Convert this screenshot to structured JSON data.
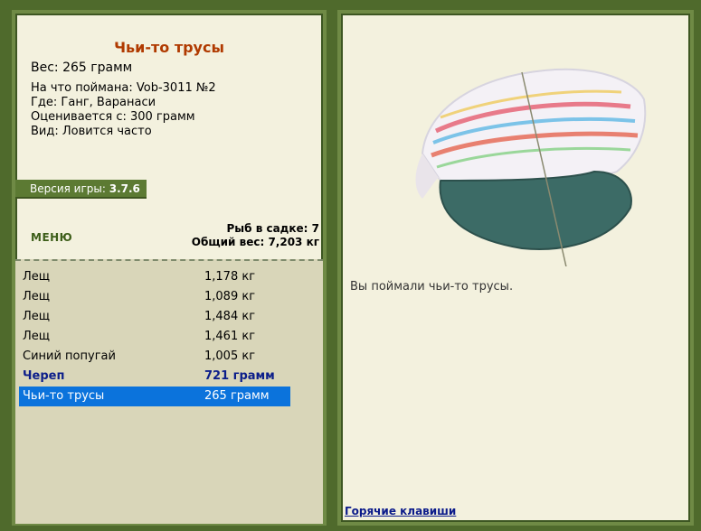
{
  "item": {
    "title": "Чьи-то трусы",
    "weight": "Вес: 265 грамм",
    "caught_on": "На что поймана: Vob-3011 №2",
    "location": "Где: Ганг, Варанаси",
    "valued_from": "Оценивается с: 300 грамм",
    "type": "Вид: Ловится часто"
  },
  "version": {
    "label": "Версия игры:",
    "value": "3.7.6"
  },
  "menu_label": "МЕНЮ",
  "stats": {
    "fish_count": "Рыб в садке: 7",
    "total_weight": "Общий вес: 7,203 кг"
  },
  "catches": [
    {
      "name": "Лещ",
      "weight": "1,178 кг"
    },
    {
      "name": "Лещ",
      "weight": "1,089 кг"
    },
    {
      "name": "Лещ",
      "weight": "1,484 кг"
    },
    {
      "name": "Лещ",
      "weight": "1,461 кг"
    },
    {
      "name": "Синий попугай",
      "weight": "1,005 кг"
    },
    {
      "name": "Череп",
      "weight": "721 грамм"
    },
    {
      "name": "Чьи-то трусы",
      "weight": "265 грамм"
    }
  ],
  "message": "Вы поймали чьи-то трусы.",
  "hotkeys_label": "Горячие клавиши"
}
